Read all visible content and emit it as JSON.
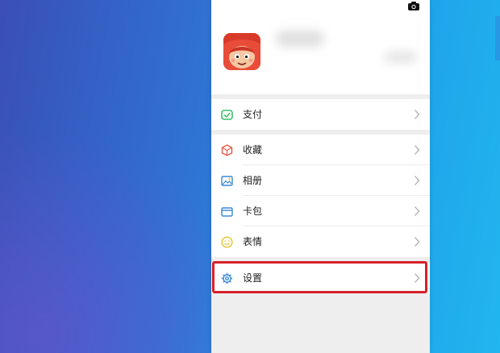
{
  "colors": {
    "highlight": "#d8202a",
    "icon_green": "#3cbf6a",
    "icon_blue": "#3a88d8",
    "icon_yellow": "#e7c63a",
    "chevron": "#b8b8b8"
  },
  "icons": {
    "camera": "camera-icon",
    "avatar": "avatar-cartoon"
  },
  "menu": {
    "pay": {
      "label": "支付",
      "icon": "pay-icon"
    },
    "favorites": {
      "label": "收藏",
      "icon": "favorites-cube-icon"
    },
    "album": {
      "label": "相册",
      "icon": "album-image-icon"
    },
    "cards": {
      "label": "卡包",
      "icon": "card-wallet-icon"
    },
    "stickers": {
      "label": "表情",
      "icon": "sticker-smile-icon"
    },
    "settings": {
      "label": "设置",
      "icon": "settings-gear-icon"
    }
  }
}
